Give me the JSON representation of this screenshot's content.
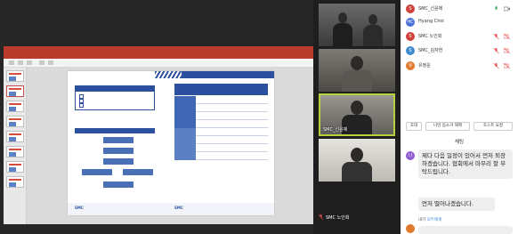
{
  "presentation": {
    "window_title": "",
    "left_box_title": "",
    "checklist": [
      "",
      "",
      ""
    ],
    "flow_title": "",
    "flow_boxes": [
      "",
      "",
      "",
      "",
      "",
      ""
    ],
    "table_title": "",
    "table_cols": [
      "",
      "",
      ""
    ],
    "table_rows": [
      [
        "",
        "",
        ""
      ],
      [
        "",
        "",
        ""
      ],
      [
        "",
        "",
        ""
      ],
      [
        "",
        "",
        ""
      ],
      [
        "",
        "",
        ""
      ],
      [
        "",
        "",
        ""
      ],
      [
        "",
        "",
        ""
      ],
      [
        "",
        "",
        ""
      ]
    ],
    "footer_logo": "SMC"
  },
  "video_tiles": [
    {
      "label": "",
      "type": "room"
    },
    {
      "label": "",
      "type": "person"
    },
    {
      "label": "SMC_신윤제",
      "type": "person"
    },
    {
      "label": "",
      "type": "person"
    }
  ],
  "bottom_name": "SMC 노인회",
  "participants": [
    {
      "initial": "S",
      "name": "SMC_신윤제",
      "color": "#d0413a"
    },
    {
      "initial": "HC",
      "name": "Hyang Choi",
      "color": "#4a6fdb"
    },
    {
      "initial": "S",
      "name": "SMC 노인회",
      "color": "#d0413a"
    },
    {
      "initial": "S",
      "name": "SMC_김자연",
      "color": "#3f8ccf"
    },
    {
      "initial": "유",
      "name": "유정운",
      "color": "#e07a2d"
    }
  ],
  "buttons": {
    "invite": "초대",
    "mute_all": "나만 음소거 해제",
    "host": "호스트 요청"
  },
  "chat": {
    "title": "채팅",
    "sender_initial": "나",
    "message_1": "제다 다음 일정이 있어서 먼저 퇴장하겠습니다. 협회에서 마무리 잘 부탁드립니다.",
    "message_2": "먼저 떨어나겠습니다.",
    "from_label": "내가",
    "from_name": "모두에게"
  },
  "colors": {
    "accent": "#2c4f9e",
    "active_speaker": "#b3d23c",
    "ppt": "#b83b2c"
  }
}
